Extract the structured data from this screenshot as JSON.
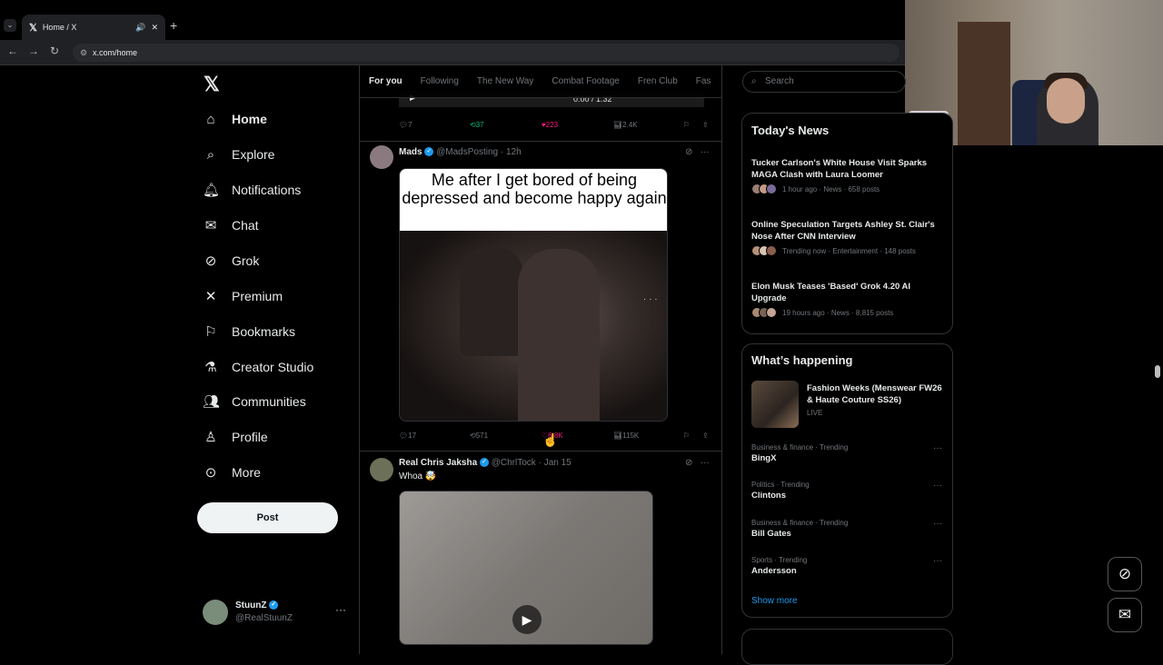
{
  "browser": {
    "tab_title": "Home / X",
    "url": "x.com/home"
  },
  "sidebar": {
    "items": [
      {
        "label": "Home",
        "icon": "home-icon"
      },
      {
        "label": "Explore",
        "icon": "search-icon"
      },
      {
        "label": "Notifications",
        "icon": "bell-icon"
      },
      {
        "label": "Chat",
        "icon": "mail-icon"
      },
      {
        "label": "Grok",
        "icon": "grok-icon"
      },
      {
        "label": "Premium",
        "icon": "x-icon"
      },
      {
        "label": "Bookmarks",
        "icon": "bookmark-icon"
      },
      {
        "label": "Creator Studio",
        "icon": "flask-icon"
      },
      {
        "label": "Communities",
        "icon": "people-icon"
      },
      {
        "label": "Profile",
        "icon": "person-icon"
      },
      {
        "label": "More",
        "icon": "more-circle-icon"
      }
    ],
    "post_label": "Post",
    "account": {
      "name": "StuunZ",
      "handle": "@RealStuunZ"
    }
  },
  "timeline": {
    "tabs": [
      "For you",
      "Following",
      "The New Way",
      "Combat Footage",
      "Fren Club",
      "Fas"
    ],
    "prev_video_time": "0:00 / 1:32",
    "prev_actions": {
      "replies": "7",
      "reposts": "37",
      "likes": "223",
      "views": "2.4K"
    },
    "tweet1": {
      "name": "Mads",
      "handle": "@MadsPosting",
      "time": "12h",
      "meme_caption": "Me after I get bored of being depressed and become happy again",
      "replies": "17",
      "reposts": "571",
      "likes": "6.8K",
      "views": "115K"
    },
    "tweet2": {
      "name": "Real Chris Jaksha",
      "handle": "@ChrlTock",
      "time": "Jan 15",
      "text": "Whoa 🤯"
    }
  },
  "right": {
    "search_placeholder": "Search",
    "news_title": "Today's News",
    "news": [
      {
        "title": "Tucker Carlson's White House Visit Sparks MAGA Clash with Laura Loomer",
        "meta": "1 hour ago · News · 658 posts"
      },
      {
        "title": "Online Speculation Targets Ashley St. Clair's Nose After CNN Interview",
        "meta": "Trending now · Entertainment · 148 posts"
      },
      {
        "title": "Elon Musk Teases 'Based' Grok 4.20 AI Upgrade",
        "meta": "19 hours ago · News · 8,815 posts"
      }
    ],
    "happening_title": "What’s happening",
    "featured": {
      "title": "Fashion Weeks (Menswear FW26 & Haute Couture SS26)",
      "status": "LIVE"
    },
    "trends": [
      {
        "category": "Business & finance · Trending",
        "name": "BingX"
      },
      {
        "category": "Politics · Trending",
        "name": "Clintons"
      },
      {
        "category": "Business & finance · Trending",
        "name": "Bill Gates"
      },
      {
        "category": "Sports · Trending",
        "name": "Andersson"
      }
    ],
    "show_more": "Show more"
  },
  "colors": {
    "accent": "#1d9bf0",
    "background": "#000000",
    "like": "#f91880",
    "repost": "#00ba7c"
  }
}
